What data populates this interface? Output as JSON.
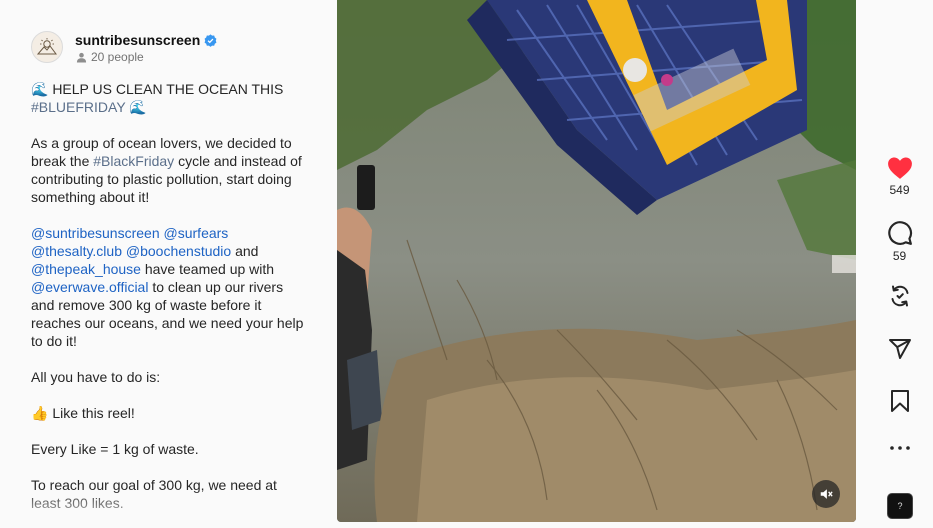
{
  "post": {
    "username": "suntribesunscreen",
    "audience": "20 people",
    "verified_color": "#3897f0"
  },
  "caption": {
    "line1": "🌊 HELP US CLEAN THE OCEAN THIS",
    "hashtag_bluefriday": "#BLUEFRIDAY",
    "wave_emoji": "🌊",
    "para2_a": "As a group of ocean lovers, we decided to break the ",
    "hashtag_blackfriday": "#BlackFriday",
    "para2_b": " cycle and instead of contributing to plastic pollution, start doing something about it!",
    "mention1": "@suntribesunscreen",
    "mention2": "@surfears",
    "mention3": "@thesalty.club",
    "mention4": "@boochenstudio",
    "and": " and",
    "mention5": "@thepeak_house",
    "teamed": " have teamed up with",
    "mention6": "@everwave.official",
    "para3_end": " to clean up our rivers and remove 300 kg of waste before it reaches our oceans, and we need your help to do it!",
    "para4": "All you have to do is:",
    "para5": "👍 Like this reel!",
    "para6": "Every Like = 1 kg of waste.",
    "para7": "To reach our goal of 300 kg, we need at least 300 likes."
  },
  "actions": {
    "likes": "549",
    "comments": "59",
    "like_color": "#ff3040"
  },
  "audio": {
    "thumb_glyph": "?"
  }
}
